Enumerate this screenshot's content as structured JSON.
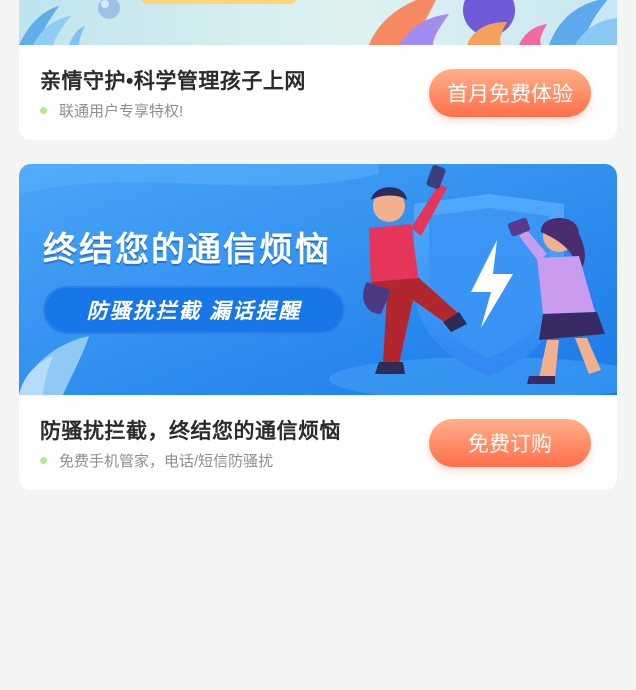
{
  "cards": [
    {
      "title": "亲情守护•科学管理孩子上网",
      "subtitle": "联通用户专享特权!",
      "cta_label": "首月免费体验"
    },
    {
      "banner_headline": "终结您的通信烦恼",
      "banner_pill": "防骚扰拦截   漏话提醒",
      "title": "防骚扰拦截，终结您的通信烦恼",
      "subtitle": "免费手机管家，电话/短信防骚扰",
      "cta_label": "免费订购"
    }
  ],
  "colors": {
    "page_bg": "#f4f4f4",
    "cta_gradient": [
      "#ffb08a",
      "#ff6f4a"
    ],
    "banner_blue": "#2f8cf2",
    "bullet_green": "#b4e98e"
  }
}
